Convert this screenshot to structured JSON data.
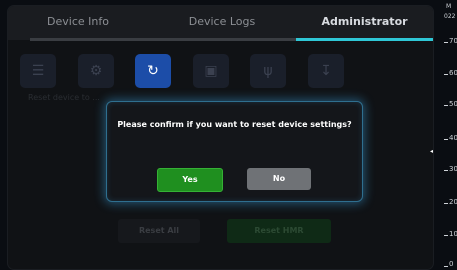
{
  "tabs": [
    {
      "label": "Device Info",
      "active": false
    },
    {
      "label": "Device Logs",
      "active": false
    },
    {
      "label": "Administrator",
      "active": true
    }
  ],
  "toolbar": {
    "buttons": [
      {
        "icon": "list-icon",
        "active": false
      },
      {
        "icon": "gear-icon",
        "active": false
      },
      {
        "icon": "reset-icon",
        "active": true
      },
      {
        "icon": "save-icon",
        "active": false
      },
      {
        "icon": "usb-icon",
        "active": false
      },
      {
        "icon": "download-icon",
        "active": false
      }
    ]
  },
  "background": {
    "section_text": "Reset device to ...",
    "reset_all_label": "Reset All",
    "reset_hmr_label": "Reset HMR"
  },
  "dialog": {
    "message": "Please confirm if you want to reset device settings?",
    "yes_label": "Yes",
    "no_label": "No"
  },
  "scale": {
    "header": "M",
    "code": "022",
    "ticks": [
      "70",
      "60",
      "50",
      "40",
      "30",
      "20",
      "10",
      "0"
    ]
  },
  "colors": {
    "accent": "#2fc7d6",
    "active_toolbar": "#1c4da8",
    "yes_green": "#1f8f1f",
    "no_grey": "#6f7276",
    "dialog_glow": "#3aa0dc"
  }
}
